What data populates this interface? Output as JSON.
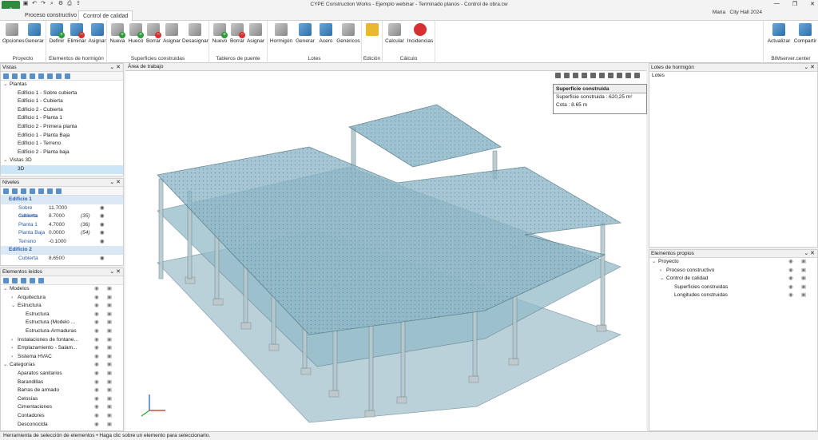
{
  "app": {
    "title": "CYPE Construction Works - Ejemplo webinar - Terminado planos - Control de obra.cw",
    "user": "Maria",
    "project": "City Hall 2024"
  },
  "tabs": [
    "Proceso constructivo",
    "Control de calidad"
  ],
  "ribbon": {
    "groups": [
      {
        "label": "Proyecto",
        "buttons": [
          "Opciones",
          "Generar"
        ]
      },
      {
        "label": "Elementos de hormigón",
        "buttons": [
          "Definir",
          "Eliminar",
          "Asignar"
        ]
      },
      {
        "label": "Superficies construidas",
        "buttons": [
          "Nueva",
          "Hueco",
          "Borrar",
          "Asignar",
          "Desasignar"
        ]
      },
      {
        "label": "Tableros de puente",
        "buttons": [
          "Nuevo",
          "Borrar",
          "Asignar"
        ]
      },
      {
        "label": "Lotes",
        "buttons": [
          "Hormigón",
          "Generar",
          "Acero",
          "Genéricos"
        ]
      },
      {
        "label": "Edición",
        "buttons": [
          ""
        ]
      },
      {
        "label": "Cálculo",
        "buttons": [
          "Calcular",
          "Incidencias"
        ]
      },
      {
        "label": "BIMserver.center",
        "buttons": [
          "Actualizar",
          "Compartir"
        ]
      }
    ]
  },
  "vistas": {
    "title": "Vistas",
    "items": [
      {
        "label": "Plantas",
        "level": 0,
        "expanded": true
      },
      {
        "label": "Edificio 1 - Sobre cubierta",
        "level": 1
      },
      {
        "label": "Edificio 1 - Cubierta",
        "level": 1
      },
      {
        "label": "Edificio 2 - Cubierta",
        "level": 1
      },
      {
        "label": "Edificio 1 - Planta 1",
        "level": 1
      },
      {
        "label": "Edificio 2 - Primera planta",
        "level": 1
      },
      {
        "label": "Edificio 1 - Planta Baja",
        "level": 1
      },
      {
        "label": "Edificio 1 - Terreno",
        "level": 1
      },
      {
        "label": "Edificio 2 - Planta baja",
        "level": 1
      },
      {
        "label": "Vistas 3D",
        "level": 0,
        "expanded": true
      },
      {
        "label": "3D",
        "level": 1,
        "selected": true
      }
    ]
  },
  "niveles": {
    "title": "Niveles",
    "groups": [
      {
        "name": "Edificio 1",
        "rows": [
          {
            "name": "Sobre cubierta",
            "cota": "11.7000",
            "h": ""
          },
          {
            "name": "Cubierta",
            "cota": "8.7000",
            "h": "(35)"
          },
          {
            "name": "Planta 1",
            "cota": "4.7000",
            "h": "(36)"
          },
          {
            "name": "Planta Baja",
            "cota": "0.0000",
            "h": "(54)"
          },
          {
            "name": "Terreno",
            "cota": "-0.1000",
            "h": ""
          }
        ]
      },
      {
        "name": "Edificio 2",
        "rows": [
          {
            "name": "Cubierta",
            "cota": "8.6500",
            "h": ""
          }
        ]
      }
    ]
  },
  "elementos": {
    "title": "Elementos leídos",
    "items": [
      {
        "label": "Modelos",
        "level": 0,
        "chev": "v"
      },
      {
        "label": "Arquitectura",
        "level": 1,
        "chev": ">"
      },
      {
        "label": "Estructura",
        "level": 1,
        "chev": "v"
      },
      {
        "label": "Estructura",
        "level": 2
      },
      {
        "label": "Estructura (Modelo ...",
        "level": 2
      },
      {
        "label": "Estructura-Armaduras",
        "level": 2
      },
      {
        "label": "Instalaciones de fontane...",
        "level": 1,
        "chev": ">"
      },
      {
        "label": "Emplazamiento - Salam...",
        "level": 1,
        "chev": ">"
      },
      {
        "label": "Sistema HVAC",
        "level": 1,
        "chev": ">"
      },
      {
        "label": "Categorías",
        "level": 0,
        "chev": "v"
      },
      {
        "label": "Aparatos sanitarios",
        "level": 1
      },
      {
        "label": "Barandillas",
        "level": 1
      },
      {
        "label": "Barras de armado",
        "level": 1
      },
      {
        "label": "Celosías",
        "level": 1
      },
      {
        "label": "Cimentaciones",
        "level": 1
      },
      {
        "label": "Contadores",
        "level": 1
      },
      {
        "label": "Desconocida",
        "level": 1
      }
    ]
  },
  "work": {
    "title": "Área de trabajo",
    "tooltip": {
      "title": "Superficie construida",
      "rows": [
        "Superficie construida : 620,25 m²",
        "Cota                     : 8.65 m"
      ]
    }
  },
  "lotes": {
    "title": "Lotes de hormigón",
    "root": "Lotes"
  },
  "propios": {
    "title": "Elementos propios",
    "items": [
      {
        "label": "Proyecto",
        "level": 0,
        "chev": "v"
      },
      {
        "label": "Proceso constructivo",
        "level": 1,
        "chev": ">"
      },
      {
        "label": "Control de calidad",
        "level": 1,
        "chev": "v"
      },
      {
        "label": "Superficies construidas",
        "level": 2
      },
      {
        "label": "Longitudes construidas",
        "level": 2
      }
    ]
  },
  "status": "Herramienta de selección de elementos • Haga clic sobre un elemento para seleccionarlo.",
  "colors": {
    "slab": "#8fb8c8",
    "accent": "#0078d4"
  }
}
